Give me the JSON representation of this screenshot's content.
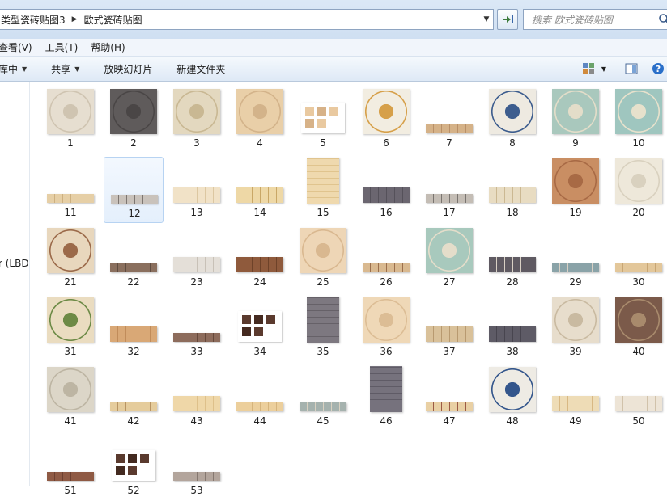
{
  "address": {
    "crumbs": [
      "类型瓷砖贴图3",
      "欧式瓷砖贴图"
    ]
  },
  "search": {
    "placeholder": "搜索 欧式瓷砖贴图"
  },
  "menu": {
    "items": [
      "查看(V)",
      "工具(T)",
      "帮助(H)"
    ]
  },
  "toolbar": {
    "library_label": "库中",
    "share_label": "共享",
    "slideshow_label": "放映幻灯片",
    "new_folder_label": "新建文件夹"
  },
  "nav": {
    "label": "r (LBD"
  },
  "colors": {
    "selection_border": "#b7d3f2",
    "toolbar_bg": "#dee9f6",
    "help_icon": "#2a6fc9"
  },
  "selected_item": "12",
  "items": [
    {
      "label": "1",
      "shape": "square",
      "c": [
        "#e6ded0",
        "#cfc4b1"
      ]
    },
    {
      "label": "2",
      "shape": "square",
      "c": [
        "#5f5b5b",
        "#4a4646"
      ]
    },
    {
      "label": "3",
      "shape": "square",
      "c": [
        "#e3d8bf",
        "#c9b893"
      ]
    },
    {
      "label": "4",
      "shape": "square",
      "c": [
        "#e9cfa8",
        "#d3b38a"
      ]
    },
    {
      "label": "5",
      "shape": "cluster",
      "c": [
        "#e9c9a0",
        "#d7b288"
      ]
    },
    {
      "label": "6",
      "shape": "square",
      "c": [
        "#f2ede1",
        "#d6a04a"
      ]
    },
    {
      "label": "7",
      "shape": "strip",
      "c": [
        "#d5b288",
        "#b99068"
      ]
    },
    {
      "label": "8",
      "shape": "square",
      "c": [
        "#eeeae1",
        "#3d5d8e"
      ]
    },
    {
      "label": "9",
      "shape": "square",
      "c": [
        "#a9c8bd",
        "#e3ddc9"
      ]
    },
    {
      "label": "10",
      "shape": "square",
      "c": [
        "#9fc6bf",
        "#e7e1cc"
      ]
    },
    {
      "label": "11",
      "shape": "strip",
      "c": [
        "#e6cfa6",
        "#cdb080"
      ]
    },
    {
      "label": "12",
      "shape": "strip",
      "c": [
        "#c9c2bb",
        "#7d7671"
      ]
    },
    {
      "label": "13",
      "shape": "band",
      "c": [
        "#f1e2c7",
        "#dcc7a1"
      ]
    },
    {
      "label": "14",
      "shape": "band",
      "c": [
        "#eed8a6",
        "#c9a766"
      ]
    },
    {
      "label": "15",
      "shape": "tall",
      "c": [
        "#efd9ae",
        "#e0c48e"
      ]
    },
    {
      "label": "16",
      "shape": "band",
      "c": [
        "#6b6670",
        "#55515a"
      ]
    },
    {
      "label": "17",
      "shape": "strip",
      "c": [
        "#c4bdb5",
        "#7a7570"
      ]
    },
    {
      "label": "18",
      "shape": "band",
      "c": [
        "#e8dcc2",
        "#cbb892"
      ]
    },
    {
      "label": "19",
      "shape": "square",
      "c": [
        "#c98e63",
        "#a86a45"
      ]
    },
    {
      "label": "20",
      "shape": "square",
      "c": [
        "#eee8da",
        "#d9d1bf"
      ]
    },
    {
      "label": "21",
      "shape": "square",
      "c": [
        "#e8d7bd",
        "#9b6a4a"
      ]
    },
    {
      "label": "22",
      "shape": "strip",
      "c": [
        "#8a6f5e",
        "#5f4c40"
      ]
    },
    {
      "label": "23",
      "shape": "band",
      "c": [
        "#e4dfd8",
        "#c8c1b7"
      ]
    },
    {
      "label": "24",
      "shape": "band",
      "c": [
        "#8f5a3c",
        "#6e4229"
      ]
    },
    {
      "label": "25",
      "shape": "square",
      "c": [
        "#eed6b6",
        "#d9b890"
      ]
    },
    {
      "label": "26",
      "shape": "strip",
      "c": [
        "#d9b990",
        "#9b6f4c"
      ]
    },
    {
      "label": "27",
      "shape": "square",
      "c": [
        "#a8c9bd",
        "#e4ddca"
      ]
    },
    {
      "label": "28",
      "shape": "band",
      "c": [
        "#5f5a62",
        "#d9d1c5"
      ]
    },
    {
      "label": "29",
      "shape": "strip",
      "c": [
        "#8aa3a8",
        "#d8d0c4"
      ]
    },
    {
      "label": "30",
      "shape": "strip",
      "c": [
        "#e3c79a",
        "#c8a674"
      ]
    },
    {
      "label": "31",
      "shape": "square",
      "c": [
        "#eadcc0",
        "#6d8a46"
      ]
    },
    {
      "label": "32",
      "shape": "band",
      "c": [
        "#d9a876",
        "#c18c5a"
      ]
    },
    {
      "label": "33",
      "shape": "strip",
      "c": [
        "#8d6c5c",
        "#66493b"
      ]
    },
    {
      "label": "34",
      "shape": "cluster",
      "c": [
        "#5b3a2e",
        "#452a20"
      ]
    },
    {
      "label": "35",
      "shape": "tall",
      "c": [
        "#7d7880",
        "#666168"
      ]
    },
    {
      "label": "36",
      "shape": "square",
      "c": [
        "#efd8b7",
        "#dcbd95"
      ]
    },
    {
      "label": "37",
      "shape": "band",
      "c": [
        "#d9c19a",
        "#b89a70"
      ]
    },
    {
      "label": "38",
      "shape": "band",
      "c": [
        "#5e5b66",
        "#48454f"
      ]
    },
    {
      "label": "39",
      "shape": "square",
      "c": [
        "#e7ddcc",
        "#c9baa1"
      ]
    },
    {
      "label": "40",
      "shape": "square",
      "c": [
        "#7b5a4a",
        "#a88a6c"
      ]
    },
    {
      "label": "41",
      "shape": "square",
      "c": [
        "#dcd6c8",
        "#bdb5a3"
      ]
    },
    {
      "label": "42",
      "shape": "strip",
      "c": [
        "#e5cc9c",
        "#b89462"
      ]
    },
    {
      "label": "43",
      "shape": "band",
      "c": [
        "#efd7a8",
        "#dec08a"
      ]
    },
    {
      "label": "44",
      "shape": "strip",
      "c": [
        "#eccf9c",
        "#d6b47c"
      ]
    },
    {
      "label": "45",
      "shape": "strip",
      "c": [
        "#a5b2ae",
        "#d9d1c1"
      ]
    },
    {
      "label": "46",
      "shape": "tall",
      "c": [
        "#76727d",
        "#5f5b66"
      ]
    },
    {
      "label": "47",
      "shape": "strip",
      "c": [
        "#e9d0a4",
        "#9b5a45"
      ]
    },
    {
      "label": "48",
      "shape": "square",
      "c": [
        "#eeebe4",
        "#34568c"
      ]
    },
    {
      "label": "49",
      "shape": "band",
      "c": [
        "#eedcb6",
        "#d8b883"
      ]
    },
    {
      "label": "50",
      "shape": "band",
      "c": [
        "#ede4d6",
        "#d1c2aa"
      ]
    },
    {
      "label": "51",
      "shape": "strip",
      "c": [
        "#8f5a44",
        "#6e4030"
      ]
    },
    {
      "label": "52",
      "shape": "cluster",
      "c": [
        "#5a3a2e",
        "#432a20"
      ]
    },
    {
      "label": "53",
      "shape": "strip",
      "c": [
        "#b3a59c",
        "#867870"
      ]
    }
  ]
}
